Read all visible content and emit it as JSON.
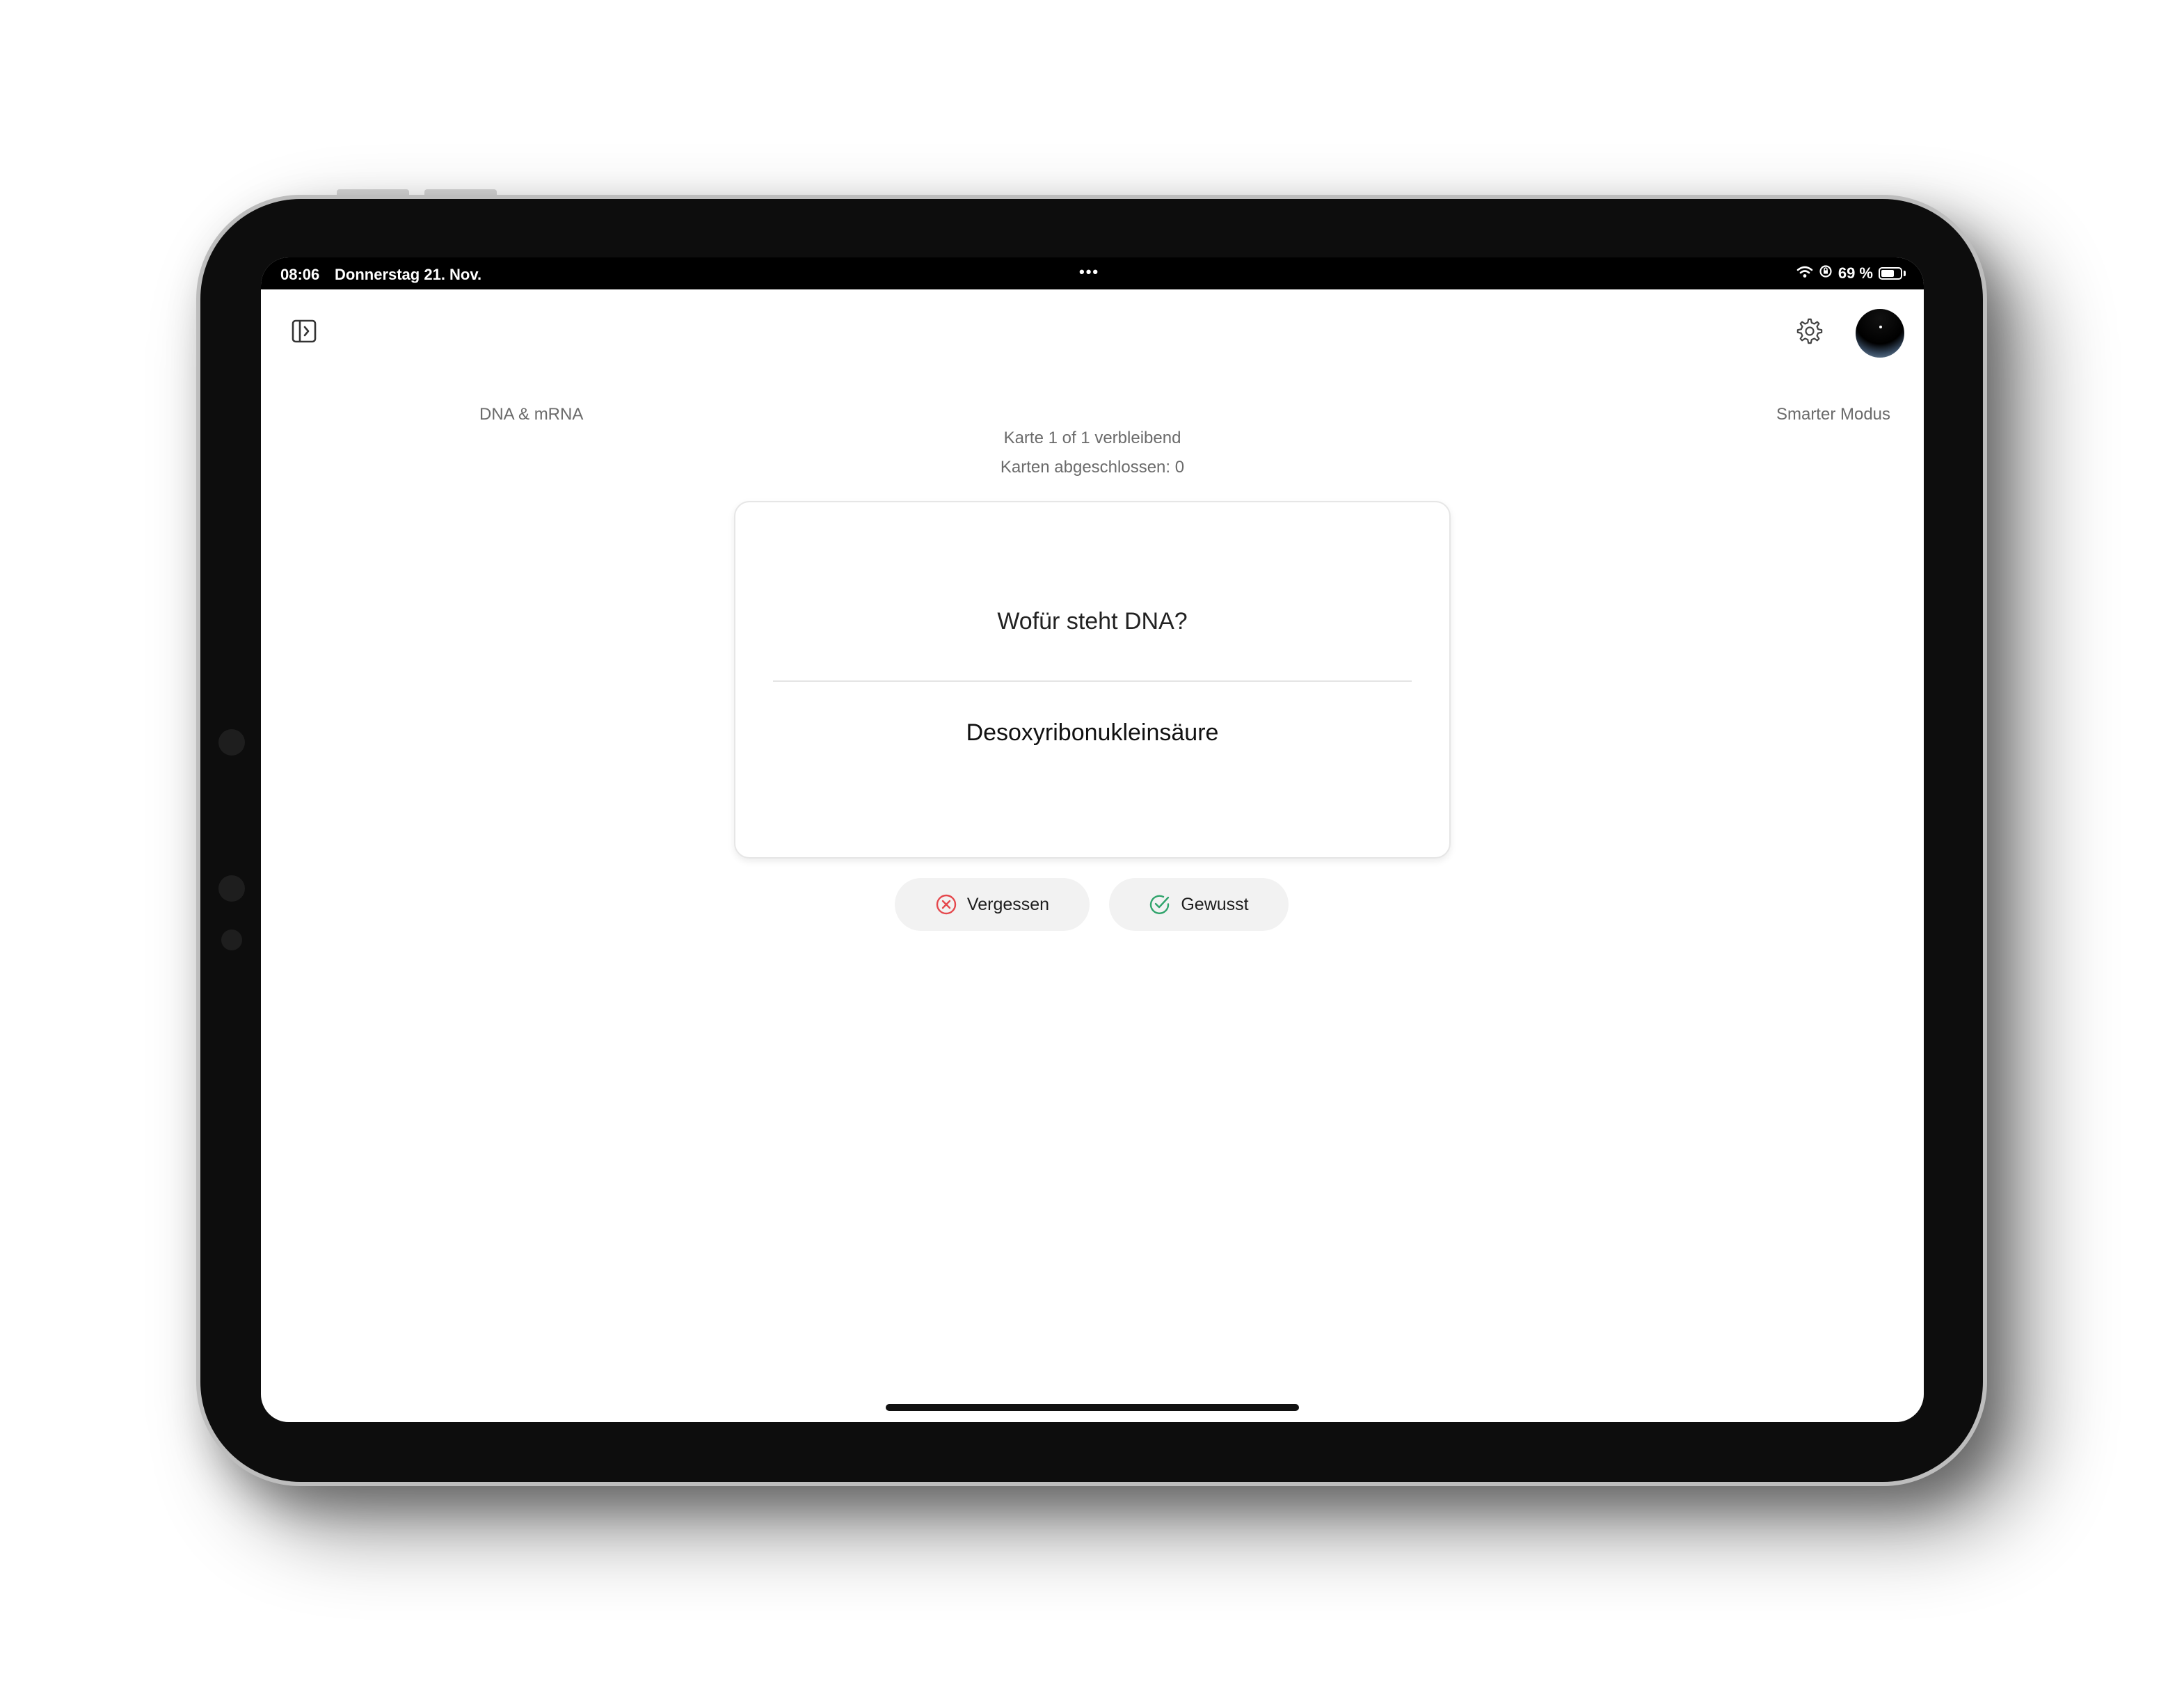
{
  "status_bar": {
    "time": "08:06",
    "date": "Donnerstag 21. Nov.",
    "multitask_dots": "•••",
    "battery_percent": "69 %",
    "battery_level": 0.69
  },
  "header": {
    "sidebar_toggle_icon": "sidebar-toggle-icon",
    "settings_icon": "gear-icon",
    "avatar": "user-avatar"
  },
  "study": {
    "deck_name": "DNA & mRNA",
    "mode_label": "Smarter Modus",
    "progress_text": "Karte 1 of 1 verbleibend",
    "completed_text": "Karten abgeschlossen: 0"
  },
  "card": {
    "question": "Wofür steht DNA?",
    "answer": "Desoxyribonukleinsäure"
  },
  "actions": {
    "forget_label": "Vergessen",
    "forget_icon": "x-circle-icon",
    "forget_color": "#e5484d",
    "known_label": "Gewusst",
    "known_icon": "check-circle-icon",
    "known_color": "#30a46c"
  }
}
